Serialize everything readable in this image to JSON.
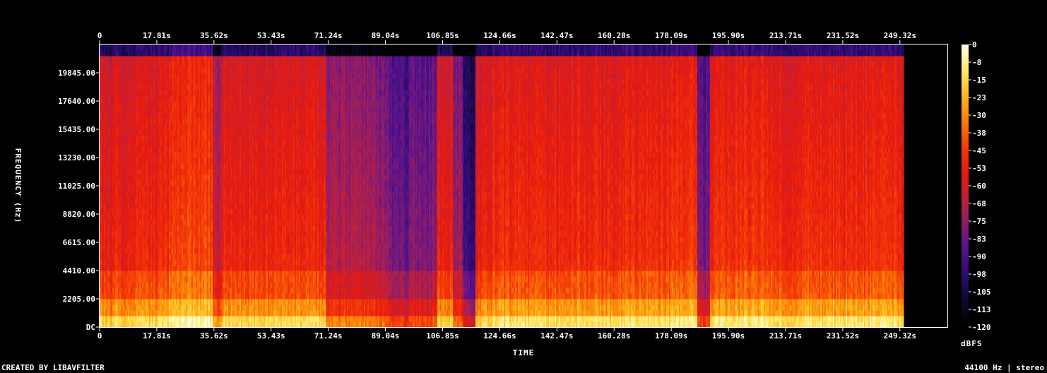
{
  "chart_data": {
    "type": "heatmap",
    "title": "",
    "xlabel": "TIME",
    "ylabel": "FREQUENCY (Hz)",
    "colorbar_label": "dBFS",
    "x_ticks": [
      "0",
      "17.81s",
      "35.62s",
      "53.43s",
      "71.24s",
      "89.04s",
      "106.85s",
      "124.66s",
      "142.47s",
      "160.28s",
      "178.09s",
      "195.90s",
      "213.71s",
      "231.52s",
      "249.32s"
    ],
    "x_tick_values": [
      0,
      17.81,
      35.62,
      53.43,
      71.24,
      89.04,
      106.85,
      124.66,
      142.47,
      160.28,
      178.09,
      195.9,
      213.71,
      231.52,
      249.32
    ],
    "xlim": [
      0,
      264.11
    ],
    "y_ticks": [
      "DC",
      "2205.00",
      "4410.00",
      "6615.00",
      "8820.00",
      "11025.00",
      "13230.00",
      "15435.00",
      "17640.00",
      "19845.00"
    ],
    "y_tick_values": [
      0,
      2205,
      4410,
      6615,
      8820,
      11025,
      13230,
      15435,
      17640,
      19845
    ],
    "ylim": [
      0,
      22050
    ],
    "colorbar_ticks": [
      "0",
      "-8",
      "-15",
      "-23",
      "-30",
      "-38",
      "-45",
      "-53",
      "-60",
      "-68",
      "-75",
      "-83",
      "-90",
      "-98",
      "-105",
      "-113",
      "-120"
    ],
    "colorbar_values": [
      0,
      -7.5,
      -15,
      -22.5,
      -30,
      -37.5,
      -45,
      -52.5,
      -60,
      -67.5,
      -75,
      -82.5,
      -90,
      -97.5,
      -105,
      -112.5,
      -120
    ],
    "colorbar_range": [
      -120,
      0
    ],
    "audio_end_s": 250.5,
    "colormap": [
      "#000000",
      "#0c0830",
      "#2a0a6e",
      "#55128c",
      "#8a1c6c",
      "#c0203a",
      "#e61a10",
      "#f43a08",
      "#fb7a08",
      "#fdb81a",
      "#fee86a",
      "#ffffe8"
    ],
    "segments": [
      {
        "start_s": 0,
        "end_s": 10,
        "level_db": -50
      },
      {
        "start_s": 10,
        "end_s": 18,
        "level_db": -48
      },
      {
        "start_s": 18,
        "end_s": 23,
        "level_db": -44
      },
      {
        "start_s": 23,
        "end_s": 35,
        "level_db": -40
      },
      {
        "start_s": 35,
        "end_s": 38,
        "level_db": -62
      },
      {
        "start_s": 38,
        "end_s": 70,
        "level_db": -48
      },
      {
        "start_s": 70,
        "end_s": 86,
        "level_db": -66
      },
      {
        "start_s": 86,
        "end_s": 90,
        "level_db": -70
      },
      {
        "start_s": 90,
        "end_s": 96,
        "level_db": -80
      },
      {
        "start_s": 96,
        "end_s": 105,
        "level_db": -75
      },
      {
        "start_s": 105,
        "end_s": 110,
        "level_db": -50
      },
      {
        "start_s": 110,
        "end_s": 113,
        "level_db": -70
      },
      {
        "start_s": 113,
        "end_s": 117,
        "level_db": -92
      },
      {
        "start_s": 117,
        "end_s": 122,
        "level_db": -50
      },
      {
        "start_s": 122,
        "end_s": 178,
        "level_db": -46
      },
      {
        "start_s": 178,
        "end_s": 186,
        "level_db": -43
      },
      {
        "start_s": 186,
        "end_s": 190,
        "level_db": -78
      },
      {
        "start_s": 190,
        "end_s": 210,
        "level_db": -44
      },
      {
        "start_s": 210,
        "end_s": 220,
        "level_db": -47
      },
      {
        "start_s": 220,
        "end_s": 250.5,
        "level_db": -45
      }
    ]
  },
  "footer": {
    "left": "CREATED BY LIBAVFILTER",
    "right": "44100 Hz | stereo"
  }
}
